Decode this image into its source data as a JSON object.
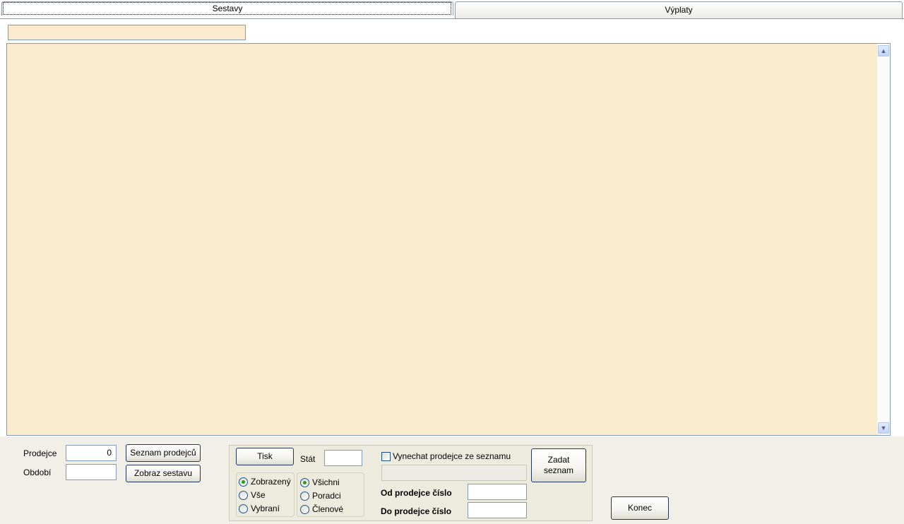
{
  "tabs": [
    {
      "label": "Sestavy",
      "active": true
    },
    {
      "label": "Výplaty",
      "active": false
    }
  ],
  "report": {
    "title_value": "",
    "content": ""
  },
  "left_controls": {
    "prodejce_label": "Prodejce",
    "prodejce_value": "0",
    "obdobi_label": "Období",
    "obdobi_value": "",
    "seznam_button": "Seznam prodejců",
    "zobraz_button": "Zobraz sestavu"
  },
  "print_panel": {
    "tisk_button": "Tisk",
    "stat_label": "Stát",
    "stat_value": "",
    "scope_options": [
      {
        "label": "Zobrazený",
        "selected": true
      },
      {
        "label": "Vše",
        "selected": false
      },
      {
        "label": "Vybraní",
        "selected": false
      }
    ],
    "people_options": [
      {
        "label": "Všichni",
        "selected": true
      },
      {
        "label": "Poradci",
        "selected": false
      },
      {
        "label": "Členové",
        "selected": false
      }
    ],
    "skip_checkbox_label": "Vynechat prodejce ze seznamu",
    "skip_checkbox_checked": false,
    "skip_list_value": "",
    "zadat_button": "Zadat seznam",
    "od_label": "Od prodejce číslo",
    "od_value": "",
    "do_label": "Do prodejce číslo",
    "do_value": ""
  },
  "konec_button": "Konec",
  "icons": {
    "scroll_up": "chevron-up-icon",
    "scroll_down": "chevron-down-icon"
  },
  "colors": {
    "report_background": "#fbebce",
    "panel_background": "#ecebde",
    "bottom_background": "#f1efe7"
  }
}
